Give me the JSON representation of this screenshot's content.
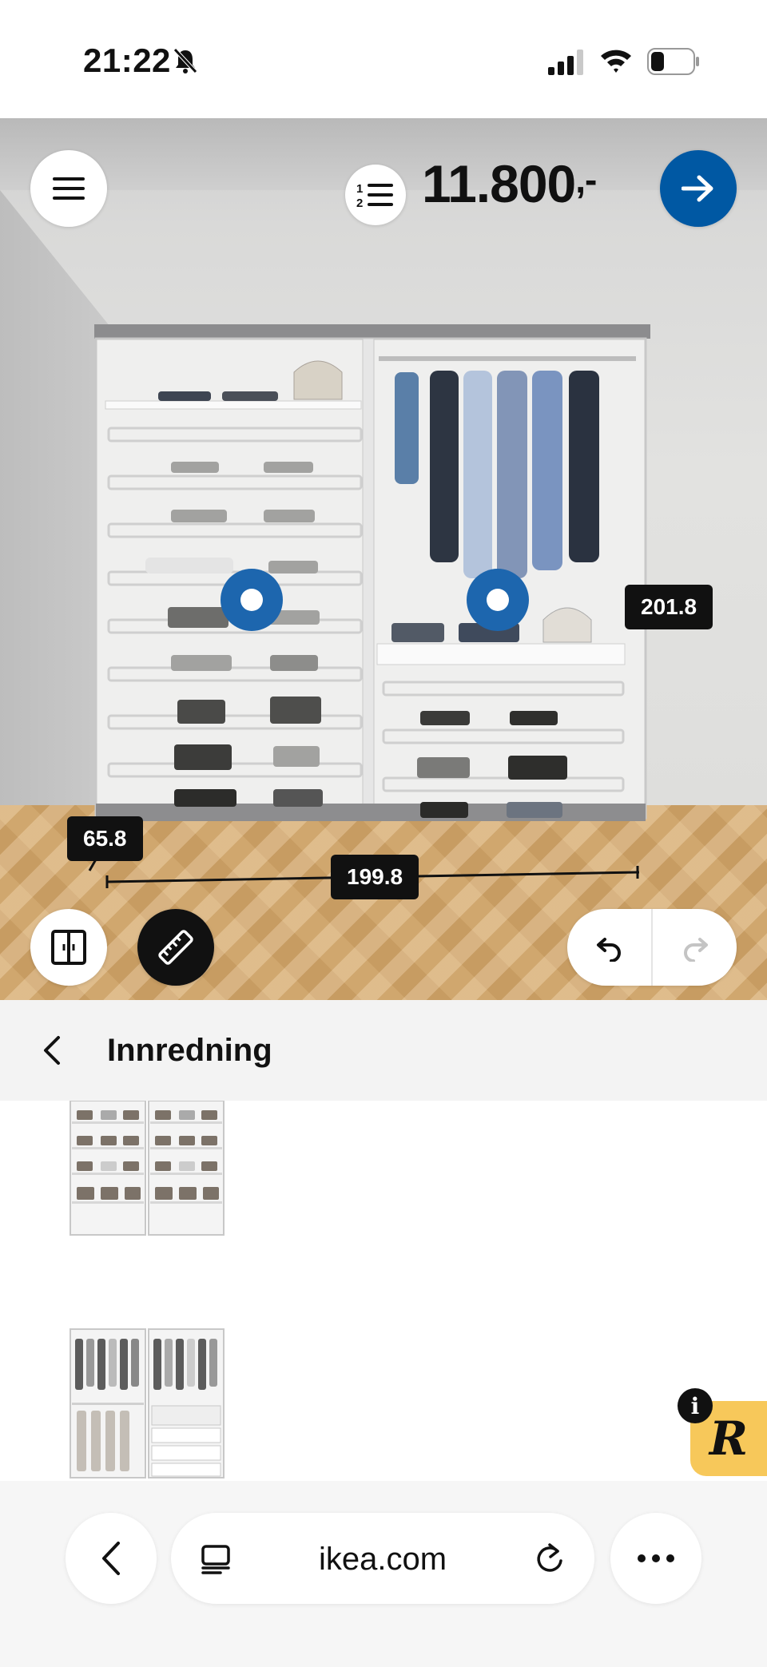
{
  "status_bar": {
    "time": "21:22",
    "icons": [
      "bell-off-icon",
      "signal-icon",
      "wifi-icon",
      "battery-icon"
    ]
  },
  "toolbar": {
    "menu_icon": "hamburger-icon",
    "list_icon": "numbered-list-icon",
    "price": "11.800",
    "price_suffix": ",-",
    "next_icon": "arrow-right-icon"
  },
  "dimensions": {
    "height": "201.8",
    "depth": "65.8",
    "width": "199.8"
  },
  "bottom_controls": {
    "layout_icon": "double-door-icon",
    "measure_icon": "ruler-icon",
    "undo_icon": "undo-icon",
    "redo_icon": "redo-icon"
  },
  "section": {
    "back_icon": "chevron-left-icon",
    "title": "Innredning"
  },
  "badge": {
    "info": "i",
    "logo_letter": "R"
  },
  "browser": {
    "url": "ikea.com",
    "back_icon": "chevron-left-icon",
    "tabs_icon": "tabs-icon",
    "reload_icon": "reload-icon",
    "more_icon": "more-icon"
  },
  "colors": {
    "accent": "#0058a3",
    "hotspot": "#1d66ae",
    "label_bg": "#111111",
    "badge": "#f7c85a"
  }
}
